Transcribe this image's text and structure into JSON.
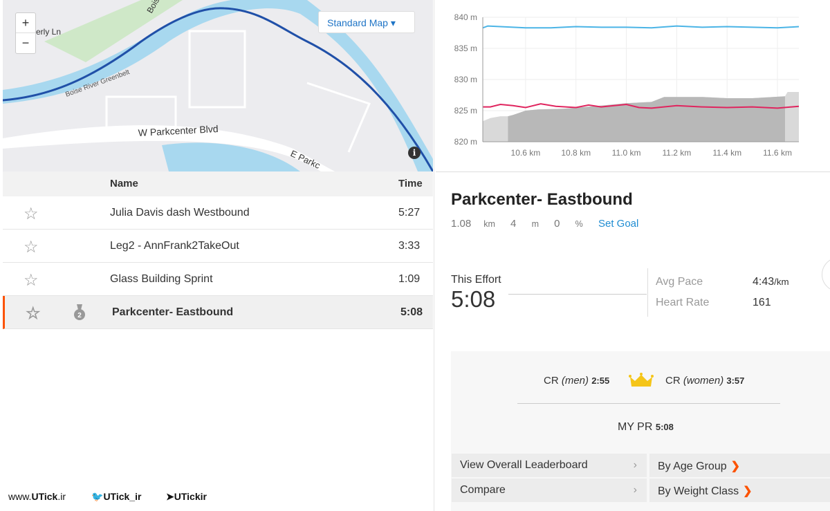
{
  "map": {
    "zoom_in": "+",
    "zoom_out": "−",
    "map_type": "Standard Map",
    "info": "i",
    "labels": [
      "W Parkcenter Blvd",
      "E Parkc",
      "Boise River Greenbelt",
      "erly Ln",
      "Bois"
    ]
  },
  "segments": {
    "header": {
      "name": "Name",
      "time": "Time"
    },
    "rows": [
      {
        "name": "Julia Davis dash Westbound",
        "time": "5:27",
        "starred": false,
        "medal": ""
      },
      {
        "name": "Leg2 - AnnFrank2TakeOut",
        "time": "3:33",
        "starred": false,
        "medal": ""
      },
      {
        "name": "Glass Building Sprint",
        "time": "1:09",
        "starred": false,
        "medal": ""
      },
      {
        "name": "Parkcenter- Eastbound",
        "time": "5:08",
        "starred": false,
        "medal": "2",
        "selected": true
      }
    ]
  },
  "chart_data": {
    "type": "line",
    "xlabel": "",
    "ylabel": "",
    "xlim": [
      10.43,
      11.685
    ],
    "ylim": [
      820,
      840
    ],
    "y_ticks": [
      "820 m",
      "825 m",
      "830 m",
      "835 m",
      "840 m"
    ],
    "y_tick_values": [
      820,
      825,
      830,
      835,
      840
    ],
    "x_ticks": [
      "10.6 km",
      "10.8 km",
      "11.0 km",
      "11.2 km",
      "11.4 km",
      "11.6 km"
    ],
    "x_tick_values": [
      10.6,
      10.8,
      11.0,
      11.2,
      11.4,
      11.6
    ],
    "grid": true,
    "elevation": {
      "x": [
        10.43,
        10.46,
        10.5,
        10.53,
        10.55,
        10.6,
        10.65,
        10.75,
        10.9,
        11.0,
        11.1,
        11.15,
        11.3,
        11.4,
        11.5,
        11.63,
        11.64,
        11.685
      ],
      "y": [
        823.3,
        823.8,
        824.1,
        824.1,
        824.3,
        825.0,
        825.2,
        825.3,
        825.8,
        826.2,
        826.4,
        827.2,
        827.2,
        827.0,
        827.0,
        827.3,
        828.0,
        828.0
      ],
      "highlight_range": [
        10.53,
        11.63
      ],
      "color": "#b8b8b8",
      "outside_color": "#d9d9d9"
    },
    "series": [
      {
        "color": "#4ab4e6",
        "x": [
          10.43,
          10.45,
          10.5,
          10.6,
          10.7,
          10.8,
          10.9,
          11.0,
          11.1,
          11.2,
          11.3,
          11.4,
          11.5,
          11.6,
          11.685
        ],
        "y": [
          838.3,
          838.6,
          838.5,
          838.3,
          838.3,
          838.5,
          838.4,
          838.4,
          838.3,
          838.6,
          838.4,
          838.5,
          838.4,
          838.3,
          838.5
        ]
      },
      {
        "color": "#e0245e",
        "x": [
          10.43,
          10.46,
          10.5,
          10.55,
          10.6,
          10.66,
          10.72,
          10.8,
          10.85,
          10.9,
          11.0,
          11.05,
          11.1,
          11.2,
          11.3,
          11.4,
          11.5,
          11.6,
          11.685
        ],
        "y": [
          825.6,
          825.6,
          826.0,
          825.8,
          825.5,
          826.1,
          825.7,
          825.5,
          825.9,
          825.6,
          826.0,
          825.5,
          825.4,
          825.8,
          825.6,
          825.5,
          825.6,
          825.4,
          825.7
        ]
      }
    ]
  },
  "segment": {
    "title": "Parkcenter- Eastbound",
    "distance": "1.08",
    "distance_unit": "km",
    "elev": "4",
    "elev_unit": "m",
    "grade": "0",
    "grade_unit": "%",
    "set_goal": "Set Goal"
  },
  "effort": {
    "label": "This Effort",
    "time": "5:08",
    "avg_pace_label": "Avg Pace",
    "avg_pace": "4:43",
    "pace_unit": "/km",
    "hr_label": "Heart Rate",
    "hr": "161"
  },
  "records": {
    "cr_men_label": "CR",
    "men": "(men)",
    "cr_men": "2:55",
    "cr_women_label": "CR",
    "women": "(women)",
    "cr_women": "3:57",
    "pr_label": "MY PR",
    "pr": "5:08",
    "crown_color": "#f5c518"
  },
  "buttons": {
    "leaderboard": "View Overall Leaderboard",
    "compare": "Compare",
    "age": "By Age Group",
    "weight": "By Weight Class",
    "chev": "›",
    "arrow": "❯"
  },
  "footer": {
    "site_pre": "www.",
    "site_bold": "UTick",
    "site_post": ".ir",
    "twitter": "UTick_ir",
    "telegram": "UTickir"
  }
}
